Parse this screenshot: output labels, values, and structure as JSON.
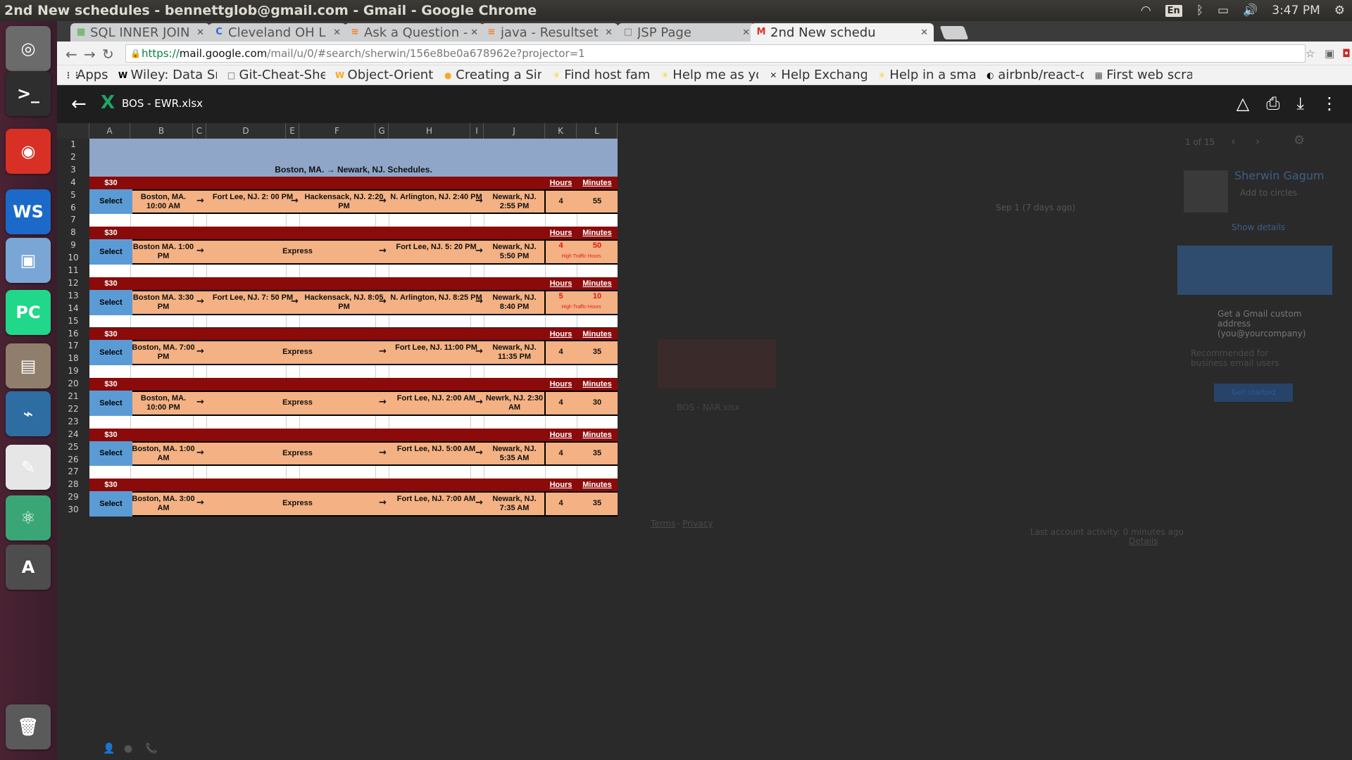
{
  "os": {
    "window_title": "2nd New schedules - bennettglob@gmail.com - Gmail - Google Chrome",
    "language": "En",
    "time": "3:47 PM"
  },
  "launcher": {
    "items": [
      {
        "name": "ubuntu-dash-icon",
        "glyph": "◎",
        "color": "#6b6b6b"
      },
      {
        "name": "terminal-icon",
        "glyph": ">_",
        "color": "#2e2e2e"
      },
      {
        "name": "chrome-icon",
        "glyph": "◉",
        "color": "#d93025"
      },
      {
        "name": "webstorm-icon",
        "glyph": "WS",
        "color": "#1b6ac9"
      },
      {
        "name": "virtualbox-icon",
        "glyph": "▣",
        "color": "#7aa6d6"
      },
      {
        "name": "pycharm-icon",
        "glyph": "PC",
        "color": "#21d789"
      },
      {
        "name": "file-manager-icon",
        "glyph": "▤",
        "color": "#8f7e6b"
      },
      {
        "name": "mysql-workbench-icon",
        "glyph": "⌁",
        "color": "#2d6da1"
      },
      {
        "name": "text-editor-icon",
        "glyph": "✎",
        "color": "#e6e6e6"
      },
      {
        "name": "atom-icon",
        "glyph": "⚛",
        "color": "#3aa675"
      },
      {
        "name": "software-updater-icon",
        "glyph": "A",
        "color": "#4d4d4d"
      },
      {
        "name": "trash-icon",
        "glyph": "🗑",
        "color": "#5a5a5a"
      }
    ]
  },
  "tabs": [
    {
      "label": "SQL INNER JOIN",
      "favicon": "SQL",
      "fav_color": "#4caf50"
    },
    {
      "label": "Cleveland OH L",
      "favicon": "C",
      "fav_color": "#3367d6"
    },
    {
      "label": "Ask a Question -",
      "favicon": "≋",
      "fav_color": "#f48024"
    },
    {
      "label": "java - Resultset",
      "favicon": "≋",
      "fav_color": "#f48024"
    },
    {
      "label": "JSP Page",
      "favicon": "□",
      "fav_color": "#777"
    },
    {
      "label": "2nd New schedu",
      "favicon": "M",
      "fav_color": "#d93025"
    }
  ],
  "address": {
    "scheme": "https://",
    "host": "mail.google.com",
    "path": "/mail/u/0/#search/sherwin/156e8be0a678962e?projector=1"
  },
  "bookmarks": [
    {
      "label": "Apps",
      "icon": "⋮⋮",
      "color": "#555"
    },
    {
      "label": "Wiley: Data Sn",
      "icon": "W",
      "color": "#000"
    },
    {
      "label": "Git-Cheat-She",
      "icon": "□",
      "color": "#666"
    },
    {
      "label": "Object-Orient",
      "icon": "W",
      "color": "#f9a825"
    },
    {
      "label": "Creating a Sin",
      "icon": "●",
      "color": "#f9a825"
    },
    {
      "label": "Find host fam",
      "icon": "✳",
      "color": "#f9d423"
    },
    {
      "label": "Help me as yo",
      "icon": "✳",
      "color": "#f9d423"
    },
    {
      "label": "Help Exchang",
      "icon": "✕",
      "color": "#333"
    },
    {
      "label": "Help in a smal",
      "icon": "✳",
      "color": "#f9d423"
    },
    {
      "label": "airbnb/react-d",
      "icon": "◐",
      "color": "#111"
    },
    {
      "label": "First web scra",
      "icon": "▦",
      "color": "#555"
    }
  ],
  "viewer": {
    "file_name": "BOS - EWR.xlsx"
  },
  "gmail_bg": {
    "pagination": "1 of 15",
    "contact_name": "Sherwin Gagum",
    "add_to_circles": "Add to circles",
    "show_details": "Show details",
    "date": "Sep 1 (7 days ago)",
    "promo_title": "Get a Gmail custom address (you@yourcompany)",
    "promo_sub": "Recommended for business email users",
    "get_started": "Get started",
    "attachment2": "BOS - NAR.xlsx",
    "terms": "Terms",
    "privacy": "Privacy",
    "last_activity": "Last account activity: 0 minutes ago",
    "details": "Details"
  },
  "sheet": {
    "columns": [
      "A",
      "B",
      "C",
      "D",
      "E",
      "F",
      "G",
      "H",
      "I",
      "J",
      "K",
      "L"
    ],
    "rows": [
      "1",
      "2",
      "3",
      "4",
      "5",
      "6",
      "7",
      "8",
      "9",
      "10",
      "11",
      "12",
      "13",
      "14",
      "15",
      "16",
      "17",
      "18",
      "19",
      "20",
      "21",
      "22",
      "23",
      "24",
      "25",
      "26",
      "27",
      "28",
      "29",
      "30"
    ],
    "title": "Boston, MA. → Newark, NJ. Schedules.",
    "hours_label": "Hours",
    "minutes_label": "Minutes",
    "select_label": "Select",
    "traffic_label": "High Traffic Hours",
    "schedules": [
      {
        "price": "$30",
        "origin": "Boston, MA. 10:00 AM",
        "stop1": "Fort Lee, NJ. 2: 00 PM",
        "stop2": "Hackensack, NJ. 2:20 PM",
        "stop3": "N. Arlington, NJ. 2:40 PM",
        "dest": "Newark, NJ. 2:55 PM",
        "hours": "4",
        "minutes": "55",
        "high_traffic": false
      },
      {
        "price": "$30",
        "origin": "Boston MA. 1:00 PM",
        "express": "Express",
        "stop3": "Fort Lee, NJ. 5: 20 PM",
        "dest": "Newark, NJ. 5:50 PM",
        "hours": "4",
        "minutes": "50",
        "high_traffic": true
      },
      {
        "price": "$30",
        "origin": "Boston MA. 3:30 PM",
        "stop1": "Fort Lee, NJ. 7: 50 PM",
        "stop2": "Hackensack, NJ. 8:05 PM",
        "stop3": "N. Arlington, NJ. 8:25 PM",
        "dest": "Newark, NJ. 8:40 PM",
        "hours": "5",
        "minutes": "10",
        "high_traffic": true
      },
      {
        "price": "$30",
        "origin": "Boston, MA. 7:00 PM",
        "express": "Express",
        "stop3": "Fort Lee, NJ. 11:00 PM",
        "dest": "Newark, NJ. 11:35 PM",
        "hours": "4",
        "minutes": "35",
        "high_traffic": false
      },
      {
        "price": "$30",
        "origin": "Boston, MA. 10:00 PM",
        "express": "Express",
        "stop3": "Fort Lee, NJ. 2:00 AM",
        "dest": "Newrk, NJ. 2:30 AM",
        "hours": "4",
        "minutes": "30",
        "high_traffic": false
      },
      {
        "price": "$30",
        "origin": "Boston, MA. 1:00 AM",
        "express": "Express",
        "stop3": "Fort Lee, NJ. 5:00 AM",
        "dest": "Newark, NJ. 5:35 AM",
        "hours": "4",
        "minutes": "35",
        "high_traffic": false
      },
      {
        "price": "$30",
        "origin": "Boston, MA. 3:00 AM",
        "express": "Express",
        "stop3": "Fort Lee, NJ. 7:00 AM",
        "dest": "Newark, NJ. 7:35 AM",
        "hours": "4",
        "minutes": "35",
        "high_traffic": false
      }
    ]
  }
}
